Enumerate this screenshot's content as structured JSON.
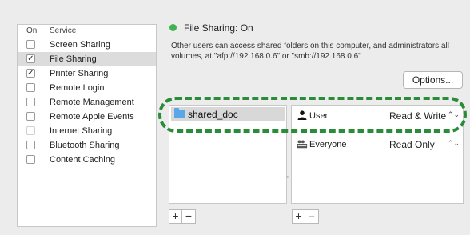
{
  "services": {
    "header_on": "On",
    "header_service": "Service",
    "items": [
      {
        "label": "Screen Sharing",
        "checked": false
      },
      {
        "label": "File Sharing",
        "checked": true
      },
      {
        "label": "Printer Sharing",
        "checked": true
      },
      {
        "label": "Remote Login",
        "checked": false
      },
      {
        "label": "Remote Management",
        "checked": false
      },
      {
        "label": "Remote Apple Events",
        "checked": false
      },
      {
        "label": "Internet Sharing",
        "checked": false
      },
      {
        "label": "Bluetooth Sharing",
        "checked": false
      },
      {
        "label": "Content Caching",
        "checked": false
      }
    ]
  },
  "status": {
    "title": "File Sharing: On",
    "color": "#3fb34f",
    "description": "Other users can access shared folders on this computer, and administrators all volumes, at \"afp://192.168.0.6\" or \"smb://192.168.0.6\""
  },
  "options_label": "Options...",
  "shared_folders": {
    "items": [
      {
        "label": "shared_doc",
        "icon": "folder-icon"
      }
    ]
  },
  "users": {
    "items": [
      {
        "name": "User",
        "icon": "user-icon",
        "permission": "Read & Write"
      },
      {
        "name": "Everyone",
        "icon": "group-icon",
        "permission": "Read Only"
      }
    ]
  },
  "buttons": {
    "add": "+",
    "remove": "−"
  },
  "highlight_color": "#2a8c39"
}
